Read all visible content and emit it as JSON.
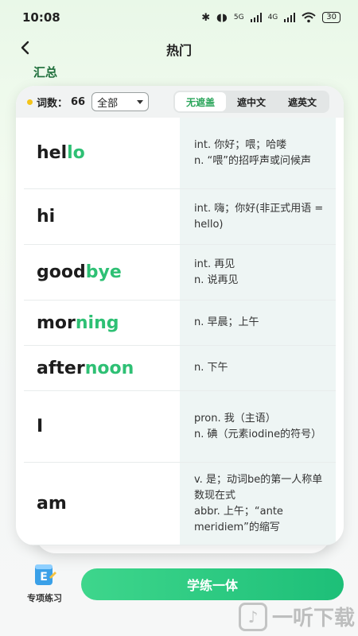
{
  "status_bar": {
    "time": "10:08",
    "signal_5g": "5G",
    "signal_4g": "4G",
    "battery": "30"
  },
  "nav": {
    "title": "热门"
  },
  "section": {
    "title": "汇总"
  },
  "toolbar": {
    "count_label": "词数：",
    "count_value": "66",
    "filter_value": "全部",
    "segments": [
      {
        "label": "无遮盖",
        "active": true
      },
      {
        "label": "遮中文",
        "active": false
      },
      {
        "label": "遮英文",
        "active": false
      }
    ]
  },
  "words": [
    {
      "prefix": "hel",
      "highlight": "lo",
      "definition": "int. 你好；喂；哈喽\nn. “喂”的招呼声或问候声"
    },
    {
      "prefix": "hi",
      "highlight": "",
      "definition": "int. 嗨；你好(非正式用语 = hello)"
    },
    {
      "prefix": "good",
      "highlight": "bye",
      "definition": "int. 再见\n n. 说再见"
    },
    {
      "prefix": "mor",
      "highlight": "ning",
      "definition": "n. 早晨；上午"
    },
    {
      "prefix": "after",
      "highlight": "noon",
      "definition": "n. 下午"
    },
    {
      "prefix": "I",
      "highlight": "",
      "definition": "pron. 我（主语）\nn. 碘（元素iodine的符号）"
    },
    {
      "prefix": "am",
      "highlight": "",
      "definition": "v. 是；动词be的第一人称单数现在式\n abbr. 上午；“ante meridiem”的缩写"
    }
  ],
  "bottom": {
    "practice_label": "专项练习",
    "primary_button": "学练一体"
  },
  "watermark": {
    "text": "一听下载"
  },
  "colors": {
    "accent": "#2ec074",
    "button": "#1dbf78",
    "section_title": "#1d6e3a"
  }
}
